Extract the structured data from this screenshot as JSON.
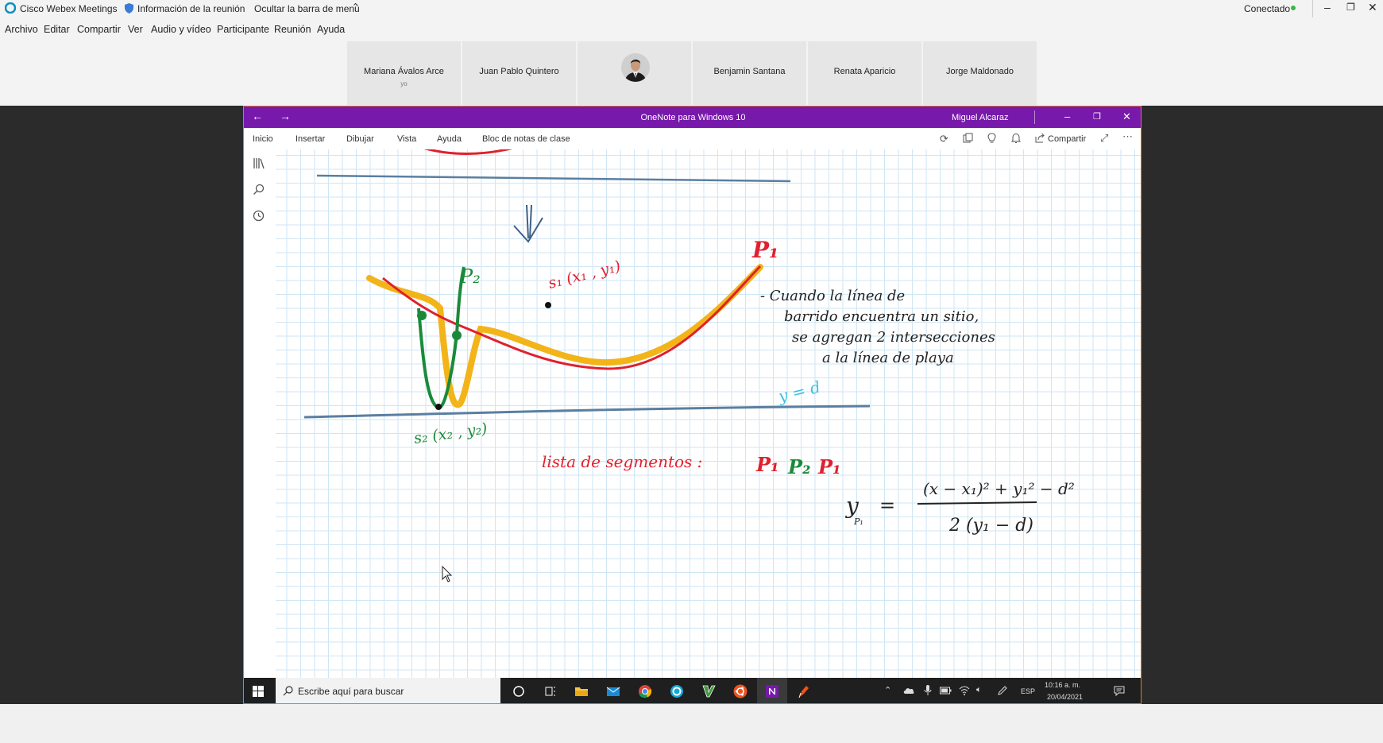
{
  "webex": {
    "app_name": "Cisco Webex Meetings",
    "meeting_info": "Información de la reunión",
    "hide_menu": "Ocultar la barra de menú",
    "status": "Conectado",
    "menu": [
      "Archivo",
      "Editar",
      "Compartir",
      "Ver",
      "Audio y vídeo",
      "Participante",
      "Reunión",
      "Ayuda"
    ],
    "participants": [
      {
        "name": "Mariana Ávalos Arce",
        "sub": "yo"
      },
      {
        "name": "Juan Pablo Quintero",
        "sub": ""
      },
      {
        "name": "",
        "sub": ""
      },
      {
        "name": "Benjamin Santana",
        "sub": ""
      },
      {
        "name": "Renata Aparicio",
        "sub": ""
      },
      {
        "name": "Jorge Maldonado",
        "sub": ""
      }
    ]
  },
  "onenote": {
    "window_title": "OneNote para Windows 10",
    "user": "Miguel Alcaraz",
    "ribbon_tabs": [
      "Inicio",
      "Insertar",
      "Dibujar",
      "Vista",
      "Ayuda",
      "Bloc de notas de clase"
    ],
    "share_label": "Compartir"
  },
  "ink": {
    "label_p1": "P₁",
    "label_p2": "P₂",
    "label_s1": "s₁ (x₁ , y₁)",
    "label_s2": "s₂ (x₂ , y₂)",
    "note_lines": [
      "- Cuando  la  línea  de",
      "barrido  encuentra  un  sitio,",
      "se  agregan  2  intersecciones",
      "a  la  línea  de  playa"
    ],
    "sweep_label": "y = d",
    "segments_label": "lista  de  segmentos  :",
    "segments_values": [
      "P₁",
      "P₂",
      "P₁"
    ],
    "formula_lhs": "y",
    "formula_lhs_sub": "P₁",
    "formula_equals": "=",
    "formula_numerator": "(x − x₁)² + y₁² − d²",
    "formula_denominator": "2 (y₁ − d)"
  },
  "taskbar": {
    "search_placeholder": "Escribe aquí para buscar",
    "language": "ESP",
    "time": "10:16 a. m.",
    "date": "20/04/2021"
  },
  "colors": {
    "onenote_purple": "#7719aa",
    "ink_red": "#e0202e",
    "ink_green": "#1a8a3a",
    "ink_yellow": "#f2b418",
    "ink_blue_line": "#5a7fa0",
    "ink_cyan": "#3ec0e0"
  }
}
